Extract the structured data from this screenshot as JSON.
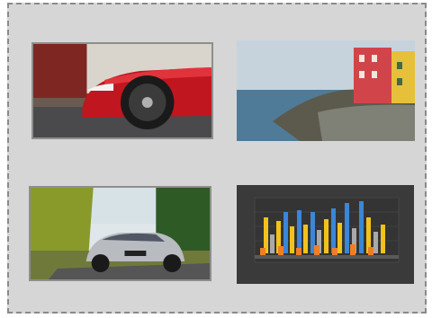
{
  "thumbnails": [
    {
      "icon": "red-sports-car-image"
    },
    {
      "icon": "coastal-houses-image"
    },
    {
      "icon": "silver-sports-car-image"
    },
    {
      "icon": "3d-bar-chart-image"
    }
  ],
  "colors": {
    "board_background": "#d6d6d6",
    "board_border": "#8a8a8a",
    "thumb_border": "#8e8e8e",
    "chart_background": "#3a3a3a",
    "bar_blue": "#3b86d6",
    "bar_yellow": "#f2c21b",
    "bar_gray": "#a9a9a9",
    "bar_orange": "#f07e26"
  }
}
